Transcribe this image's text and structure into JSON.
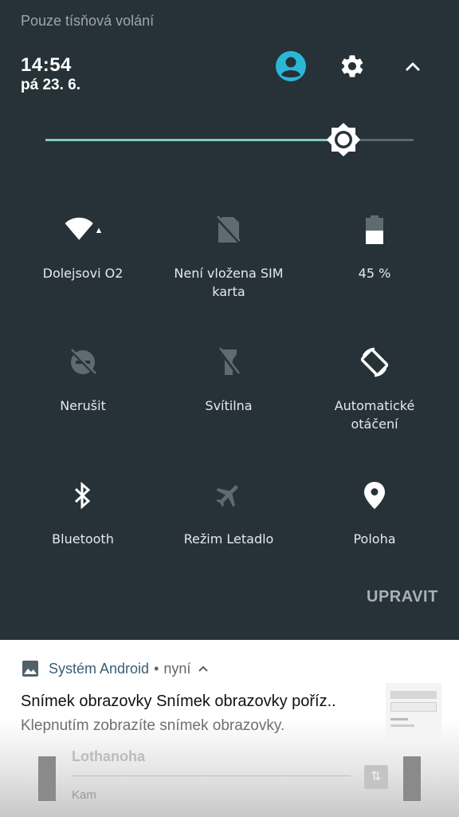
{
  "status": {
    "emergency_text": "Pouze tísňová volání"
  },
  "header": {
    "time": "14:54",
    "date": "pá 23. 6."
  },
  "brightness": {
    "level": 0.81
  },
  "tiles": [
    {
      "label": "Dolejsovi O2",
      "icon": "wifi-icon"
    },
    {
      "label": "Není vložena SIM\nkarta",
      "icon": "no-sim-icon"
    },
    {
      "label": "45 %",
      "icon": "battery-icon"
    },
    {
      "label": "Nerušit",
      "icon": "do-not-disturb-off-icon"
    },
    {
      "label": "Svítilna",
      "icon": "flashlight-off-icon"
    },
    {
      "label": "Automatické\notáčení",
      "icon": "auto-rotate-icon"
    },
    {
      "label": "Bluetooth",
      "icon": "bluetooth-icon"
    },
    {
      "label": "Režim Letadlo",
      "icon": "airplane-mode-icon"
    },
    {
      "label": "Poloha",
      "icon": "location-icon"
    }
  ],
  "edit_label": "UPRAVIT",
  "notification": {
    "app_name": "Systém Android",
    "separator": "•",
    "time": "nyní",
    "title": "Snímek obrazovky Snímek obrazovky poříz..",
    "text": "Klepnutím zobrazíte snímek obrazovky."
  },
  "background_notification": {
    "title": "Lothanoha",
    "subtitle": "Kam"
  },
  "colors": {
    "panel_bg": "#263238",
    "accent": "#80cbc4",
    "avatar": "#2ab7d6"
  }
}
